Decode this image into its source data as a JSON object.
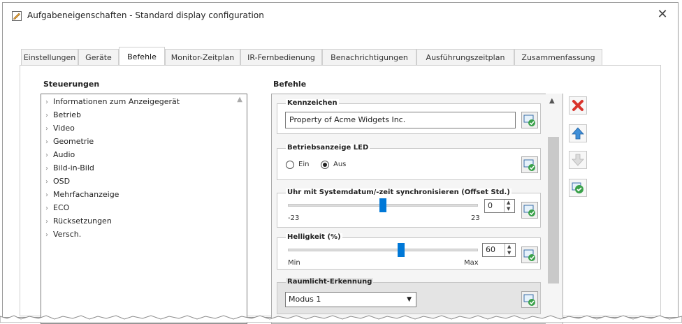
{
  "window": {
    "title": "Aufgabeneigenschaften - Standard display configuration",
    "close_label": "✕"
  },
  "tabs": [
    {
      "label": "Einstellungen"
    },
    {
      "label": "Geräte"
    },
    {
      "label": "Befehle",
      "active": true
    },
    {
      "label": "Monitor-Zeitplan"
    },
    {
      "label": "IR-Fernbedienung"
    },
    {
      "label": "Benachrichtigungen"
    },
    {
      "label": "Ausführungszeitplan"
    },
    {
      "label": "Zusammenfassung"
    }
  ],
  "controls_panel": {
    "title": "Steuerungen",
    "items": [
      {
        "label": "Informationen zum Anzeigegerät"
      },
      {
        "label": "Betrieb"
      },
      {
        "label": "Video"
      },
      {
        "label": "Geometrie"
      },
      {
        "label": "Audio"
      },
      {
        "label": "Bild-in-Bild"
      },
      {
        "label": "OSD"
      },
      {
        "label": "Mehrfachanzeige"
      },
      {
        "label": "ECO"
      },
      {
        "label": "Rücksetzungen"
      },
      {
        "label": "Versch."
      }
    ]
  },
  "commands_panel": {
    "title": "Befehle",
    "kennzeichen": {
      "title": "Kennzeichen",
      "value": "Property of Acme Widgets Inc."
    },
    "led": {
      "title": "Betriebsanzeige LED",
      "option_on": "Ein",
      "option_off": "Aus",
      "selected": "Aus"
    },
    "clock": {
      "title": "Uhr mit Systemdatum/-zeit synchronisieren (Offset Std.)",
      "min_label": "-23",
      "max_label": "23",
      "min": -23,
      "max": 23,
      "value": "0"
    },
    "brightness": {
      "title": "Helligkeit (%)",
      "min_label": "Min",
      "max_label": "Max",
      "value": "60",
      "percent": 60
    },
    "ambient": {
      "title": "Raumlicht-Erkennung",
      "selected": "Modus 1"
    }
  },
  "side_buttons": [
    {
      "icon": "delete-icon",
      "color": "#d9332b"
    },
    {
      "icon": "arrow-up-icon",
      "color": "#3f8fd8"
    },
    {
      "icon": "arrow-down-icon",
      "color": "#c8c8c8"
    },
    {
      "icon": "copy-icon",
      "color": "#3aa14a"
    }
  ],
  "colors": {
    "accent": "#0078d7"
  }
}
